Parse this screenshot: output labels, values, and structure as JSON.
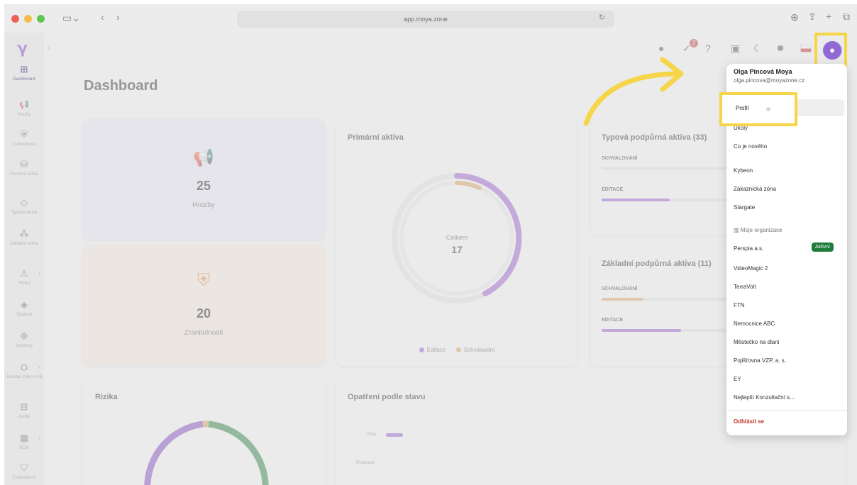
{
  "browser": {
    "url": "app.moya.zone",
    "dot_colors": [
      "#ee5f57",
      "#f4be4f",
      "#5fc454"
    ]
  },
  "sidebar": {
    "logo": "γ",
    "items": [
      {
        "label": "Dashboard",
        "icon": "dashboard-icon",
        "glyph": "⊞"
      },
      {
        "label": "Hrozby",
        "icon": "megaphone-icon",
        "glyph": "📢"
      },
      {
        "label": "Zranitelnosti",
        "icon": "shield-icon",
        "glyph": "⛨"
      },
      {
        "label": "Primární aktiva",
        "icon": "assets-icon",
        "glyph": "⛁"
      },
      {
        "label": "Typová aktiva",
        "icon": "tag-icon",
        "glyph": "◇"
      },
      {
        "label": "Základní aktiva",
        "icon": "shapes-icon",
        "glyph": "⁂"
      },
      {
        "label": "Rizika",
        "icon": "warning-icon",
        "glyph": "⚠"
      },
      {
        "label": "Opatření",
        "icon": "diamond-icon",
        "glyph": "◈"
      },
      {
        "label": "Incidenty",
        "icon": "incident-icon",
        "glyph": "⊛"
      },
      {
        "label": "Jednání výboru KB",
        "icon": "meeting-icon",
        "glyph": "⛭"
      },
      {
        "label": "Audity",
        "icon": "briefcase-icon",
        "glyph": "⊟"
      },
      {
        "label": "BCM",
        "icon": "bcm-icon",
        "glyph": "▦"
      },
      {
        "label": "Zranitelnosti",
        "icon": "shield-icon",
        "glyph": "⛉"
      }
    ]
  },
  "page": {
    "title": "Dashboard"
  },
  "stats": {
    "threats": {
      "value": "25",
      "label": "Hrozby"
    },
    "vulnerabilities": {
      "value": "20",
      "label": "Zranitelnosti"
    }
  },
  "primary_assets": {
    "title": "Primární aktiva",
    "center_label": "Celkem",
    "total": "17",
    "legend": [
      "Editace",
      "Schvalování"
    ]
  },
  "typical_assets": {
    "title": "Typová podpůrná aktiva (33)",
    "row1": "SCHVALOVÁNÍ",
    "row2": "EDITACE"
  },
  "basic_assets": {
    "title": "Základní podpůrná aktiva (11)",
    "row1": "SCHVALOVÁNÍ",
    "row2": "EDITACE"
  },
  "risks": {
    "title": "Rizika"
  },
  "measures": {
    "title": "Opatření podle stavu",
    "row1": "Plán",
    "row2": "Realizace"
  },
  "notification_count": "7",
  "colors": {
    "purple": "#9a55d6",
    "orange": "#e0a05a",
    "green": "#1d7b37",
    "highlight": "#f7d548"
  },
  "user_menu": {
    "name": "Olga Pincová Moya",
    "email": "olga.pincova@moyazone.cz",
    "items": [
      "Profil",
      "Úkoly",
      "Co je nového",
      "Kybeon",
      "Zákaznická zóna",
      "Stargate"
    ],
    "org_header": "Moje organizace",
    "orgs": [
      "Perspia a.s.",
      "VideoMagic 2",
      "TerraVolt",
      "FTN",
      "Nemocnice ABC",
      "Městečko na dlani",
      "Pojišťovna VZP, a. s.",
      "EY",
      "Nejlepší Konzultační s..."
    ],
    "active_badge": "Aktivní",
    "logout": "Odhlásit se"
  }
}
